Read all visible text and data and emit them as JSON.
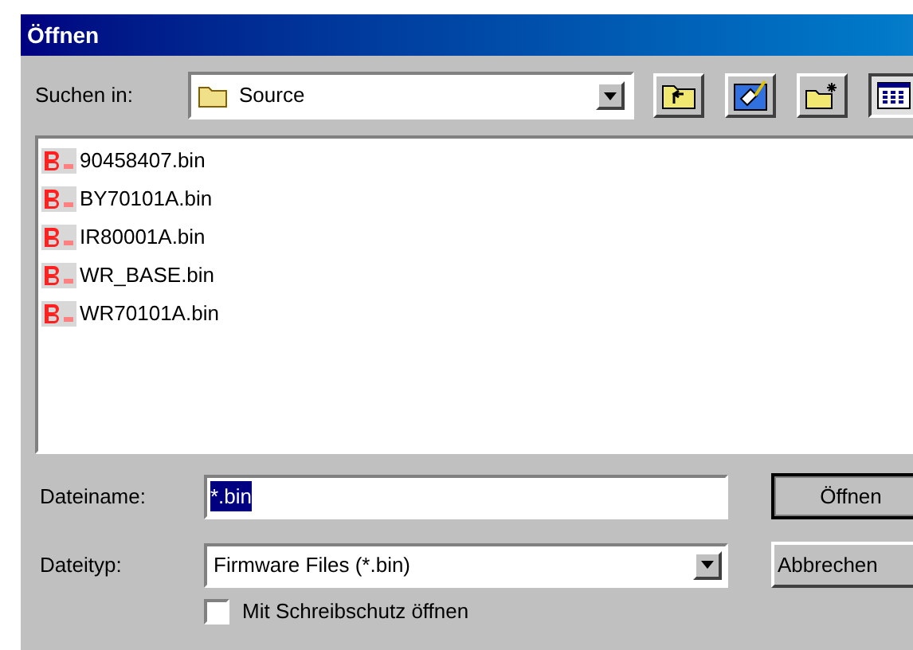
{
  "window": {
    "title": "Öffnen"
  },
  "look_in": {
    "label": "Suchen in:",
    "value": "Source"
  },
  "toolbar": [
    {
      "kind": "up",
      "pressed": false
    },
    {
      "kind": "desktop",
      "pressed": false
    },
    {
      "kind": "newfolder",
      "pressed": false
    },
    {
      "kind": "details",
      "pressed": true
    }
  ],
  "files": [
    {
      "name": "90458407.bin",
      "selected": false
    },
    {
      "name": "BY70101A.bin",
      "selected": false
    },
    {
      "name": "IR80001A.bin",
      "selected": false
    },
    {
      "name": "WR_BASE.bin",
      "selected": false
    },
    {
      "name": "WR70101A.bin",
      "selected": false
    }
  ],
  "filename": {
    "label": "Dateiname:",
    "value": "*.bin",
    "selected": true
  },
  "filetype": {
    "label": "Dateityp:",
    "value": "Firmware Files (*.bin)"
  },
  "readonly": {
    "label": "Mit Schreibschutz öffnen",
    "checked": false
  },
  "buttons": [
    {
      "label": "Öffnen",
      "default": true
    },
    {
      "label": "Abbrechen",
      "default": false
    }
  ]
}
